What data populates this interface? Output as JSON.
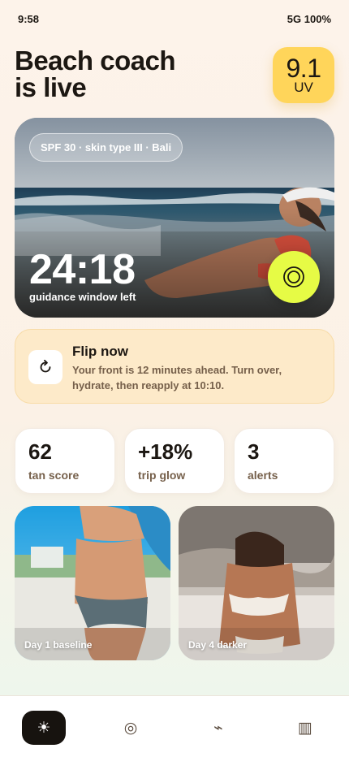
{
  "status_bar": {
    "time": "9:58",
    "network": "5G 100%"
  },
  "header": {
    "title_line1": "Beach coach",
    "title_line2": "is live"
  },
  "uv": {
    "value": "9.1",
    "label": "UV"
  },
  "hero": {
    "chip": "SPF 30 · skin type III · Bali",
    "timer": "24:18",
    "timer_label": "guidance window left",
    "target_icon": "target-icon"
  },
  "flip": {
    "icon": "refresh-icon",
    "title": "Flip now",
    "body": "Your front is 12 minutes ahead. Turn over, hydrate, then reapply at 10:10."
  },
  "stats": [
    {
      "value": "62",
      "label": "tan score"
    },
    {
      "value": "+18%",
      "label": "trip glow"
    },
    {
      "value": "3",
      "label": "alerts"
    }
  ],
  "photos": [
    {
      "caption": "Day 1 baseline"
    },
    {
      "caption": "Day 4 darker"
    }
  ],
  "nav": [
    {
      "icon": "sun-icon",
      "glyph": "☀",
      "active": true
    },
    {
      "icon": "target-icon",
      "glyph": "◎",
      "active": false
    },
    {
      "icon": "bolt-icon",
      "glyph": "⌁",
      "active": false
    },
    {
      "icon": "barcode-icon",
      "glyph": "▥",
      "active": false
    }
  ],
  "colors": {
    "accent_yellow": "#ffd55a",
    "accent_lime": "#e6fb45",
    "flip_bg": "#fdeac9",
    "text_muted": "#76604b"
  }
}
